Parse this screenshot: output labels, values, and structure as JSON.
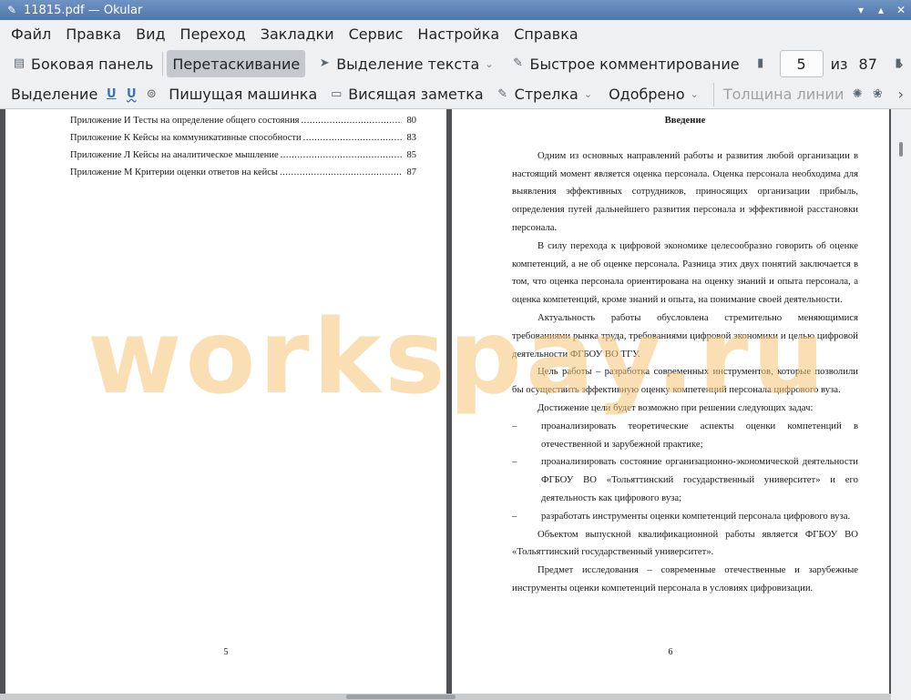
{
  "window": {
    "title": "11815.pdf  — Okular",
    "icon": "okular-icon"
  },
  "menu": [
    "Файл",
    "Правка",
    "Вид",
    "Переход",
    "Закладки",
    "Сервис",
    "Настройка",
    "Справка"
  ],
  "toolbar1": {
    "sidebar": "Боковая панель",
    "drag": "Перетаскивание",
    "text_select": "Выделение текста",
    "quick_comment": "Быстрое комментирование",
    "page_current": "5",
    "page_of": "из",
    "page_total": "87"
  },
  "toolbar2": {
    "highlight": "Выделение",
    "typewriter": "Пишущая машинка",
    "note": "Висящая заметка",
    "arrow": "Стрелка",
    "stamp": "Одобрено",
    "line_width": "Толщина линии"
  },
  "left_page": {
    "toc": [
      {
        "title": "Приложение И Тесты на определение общего состояния",
        "page": "80"
      },
      {
        "title": "Приложение К Кейсы на коммуникативные способности",
        "page": "83"
      },
      {
        "title": "Приложение Л Кейсы на аналитическое мышление",
        "page": "85"
      },
      {
        "title": "Приложение М Критерии оценки ответов на кейсы",
        "page": "87"
      }
    ],
    "number": "5"
  },
  "right_page": {
    "heading": "Введение",
    "p1": "Одним из основных направлений работы и развития любой организации в настоящий момент является оценка персонала. Оценка персонала необходима для выявления эффективных сотрудников, приносящих организации прибыль, определения путей дальнейшего развития персонала и эффективной расстановки персонала.",
    "p2": "В силу перехода к цифровой экономике целесообразно говорить об оценке компетенций, а не об оценке персонала. Разница этих двух понятий заключается в том, что оценка персонала ориентирована на оценку знаний и опыта персонала, а оценка компетенций, кроме знаний и опыта, на понимание своей деятельности.",
    "p3": "Актуальность работы обусловлена стремительно меняющимися требованиями рынка труда, требованиями цифровой экономики и целью цифровой деятельности ФГБОУ ВО ТГУ.",
    "p4": "Цель работы – разработка современных инструментов, которые позволили бы осуществить эффективную оценку компетенций персонала цифрового вуза.",
    "p5": "Достижение цели будет возможно при решении следующих задач:",
    "list": [
      "проанализировать теоретические аспекты оценки компетенций в отечественной и зарубежной практике;",
      "проанализировать состояние организационно-экономической деятельности ФГБОУ ВО «Тольяттинский государственный университет» и его деятельность как цифрового вуза;",
      "разработать инструменты оценки компетенций персонала цифрового вуза."
    ],
    "p6": "Объектом выпускной квалификационной работы является ФГБОУ ВО «Тольяттинский государственный университет».",
    "p7": "Предмет исследования – современные отечественные и зарубежные инструменты оценки компетенций персонала в условиях цифровизации.",
    "number": "6",
    "dash": "–"
  },
  "watermark": "workspay.ru"
}
